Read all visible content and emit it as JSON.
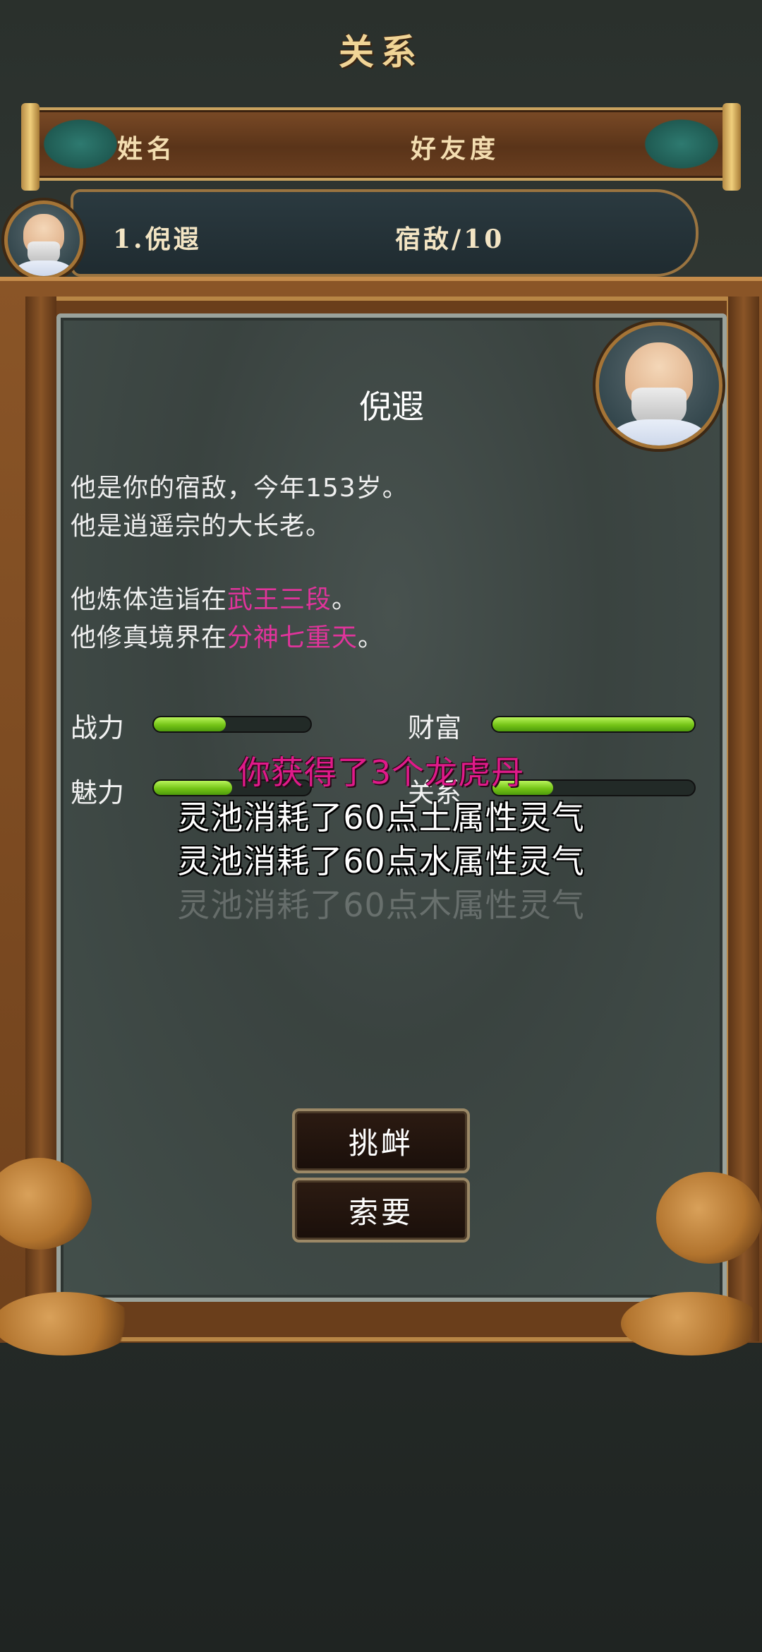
{
  "page_title": "关系",
  "header": {
    "col_name": "姓名",
    "col_affinity": "好友度"
  },
  "list": [
    {
      "index_name": "1.倪遐",
      "relation": "宿敌/10"
    }
  ],
  "dialog": {
    "name": "倪遐",
    "desc_line1": "他是你的宿敌，今年153岁。",
    "desc_line2": "他是逍遥宗的大长老。",
    "body_prefix": "他炼体造诣在",
    "body_value": "武王三段",
    "body_suffix": "。",
    "realm_prefix": "他修真境界在",
    "realm_value": "分神七重天",
    "realm_suffix": "。",
    "stats": {
      "power_label": "战力",
      "power_level": 0.46,
      "wealth_label": "财富",
      "wealth_level": 1.0,
      "charm_label": "魅力",
      "charm_level": 0.5,
      "relation_label": "关系",
      "relation_level": 0.3
    },
    "buttons": {
      "provoke": "挑衅",
      "demand": "索要"
    }
  },
  "notifications": {
    "reward": "你获得了3个龙虎丹",
    "consume_earth": "灵池消耗了60点土属性灵气",
    "consume_water": "灵池消耗了60点水属性灵气",
    "consume_wood": "灵池消耗了60点木属性灵气"
  },
  "colors": {
    "highlight": "#e0349b",
    "bar_green": "#74c417",
    "frame_wood": "#8a5527",
    "title_gold": "#f0d496"
  }
}
